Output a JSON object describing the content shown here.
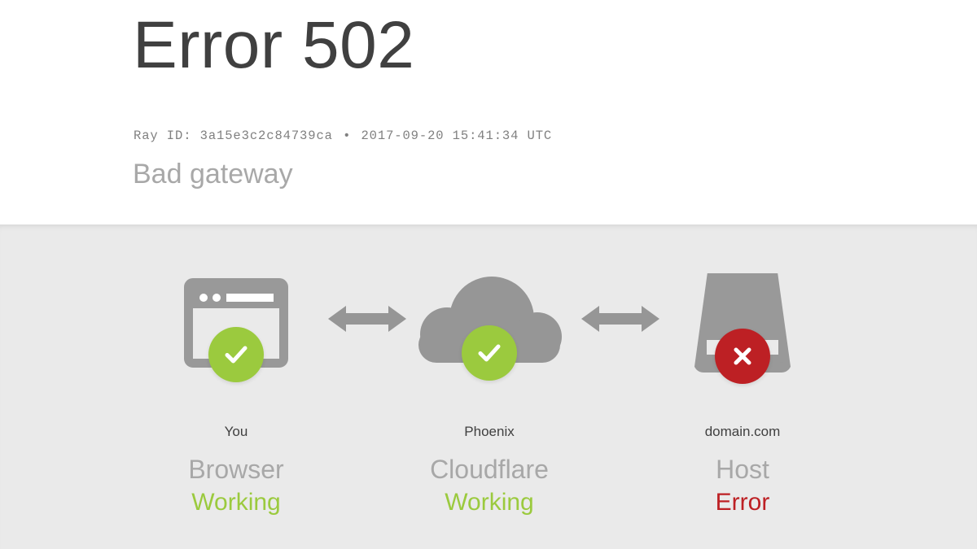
{
  "header": {
    "title": "Error 502",
    "ray_id_label": "Ray ID:",
    "ray_id": "3a15e3c2c84739ca",
    "separator": "•",
    "timestamp": "2017-09-20 15:41:34 UTC",
    "subtitle": "Bad gateway"
  },
  "colors": {
    "page_background": "#ffffff",
    "panel_background": "#eaeaea",
    "title_text": "#404040",
    "muted_text": "#a8a8a8",
    "mono_text": "#808080",
    "icon_gray": "#969696",
    "status_ok": "#9bca3e",
    "status_error": "#bd2024"
  },
  "panel": {
    "nodes": [
      {
        "id": "browser",
        "icon": "browser-window-icon",
        "badge": "check-circle-icon",
        "badge_state": "ok",
        "label": "You",
        "name": "Browser",
        "status": "Working"
      },
      {
        "id": "cloudflare",
        "icon": "cloud-icon",
        "badge": "check-circle-icon",
        "badge_state": "ok",
        "label": "Phoenix",
        "name": "Cloudflare",
        "status": "Working"
      },
      {
        "id": "host",
        "icon": "server-icon",
        "badge": "x-circle-icon",
        "badge_state": "error",
        "label": "domain.com",
        "name": "Host",
        "status": "Error"
      }
    ],
    "connectors": [
      {
        "id": "connector-1",
        "icon": "double-arrow-icon"
      },
      {
        "id": "connector-2",
        "icon": "double-arrow-icon"
      }
    ]
  }
}
